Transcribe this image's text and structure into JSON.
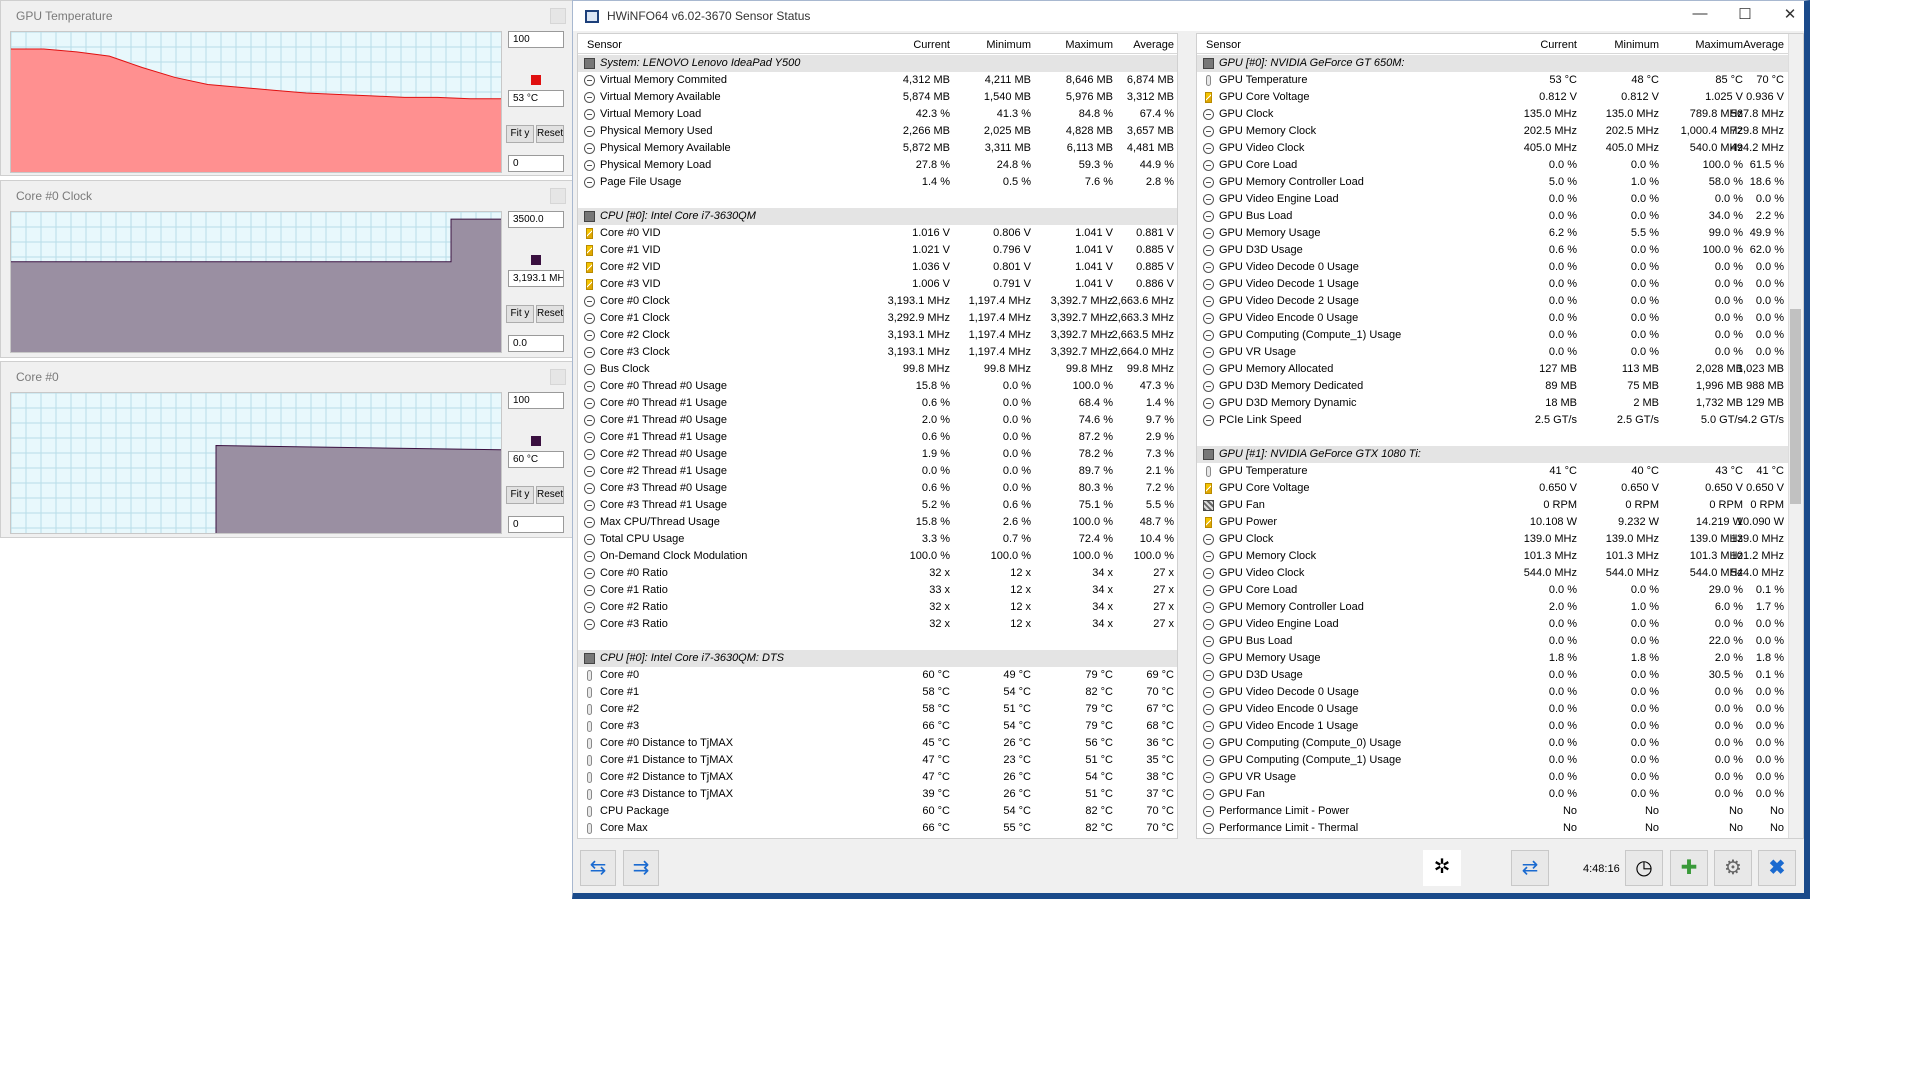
{
  "graphs": [
    {
      "title": "GPU Temperature",
      "max": "100",
      "current": "53 °C",
      "min": "0",
      "fit": "Fit y",
      "reset": "Reset",
      "color": "#e01010",
      "fill": "#ff9090",
      "level": 0.53
    },
    {
      "title": "Core #0 Clock",
      "max": "3500.0",
      "current": "3,193.1 MH:",
      "min": "0.0",
      "fit": "Fit y",
      "reset": "Reset",
      "color": "#3a1040",
      "fill": "#9a8fa2",
      "level": 0.91
    },
    {
      "title": "Core #0",
      "max": "100",
      "current": "60 °C",
      "min": "0",
      "fit": "Fit y",
      "reset": "Reset",
      "color": "#3a1040",
      "fill": "#9a8fa2",
      "level": 0.6
    }
  ],
  "window": {
    "title": "HWiNFO64 v6.02-3670 Sensor Status",
    "minimize": "—",
    "maximize": "☐",
    "close": "✕"
  },
  "columns": {
    "sensor": "Sensor",
    "current": "Current",
    "minimum": "Minimum",
    "maximum": "Maximum",
    "average": "Average"
  },
  "left_rows": [
    {
      "g": 1,
      "n": "System: LENOVO Lenovo IdeaPad Y500"
    },
    {
      "i": "clk",
      "n": "Virtual Memory Commited",
      "c": "4,312 MB",
      "mi": "4,211 MB",
      "ma": "8,646 MB",
      "a": "6,874 MB"
    },
    {
      "i": "clk",
      "n": "Virtual Memory Available",
      "c": "5,874 MB",
      "mi": "1,540 MB",
      "ma": "5,976 MB",
      "a": "3,312 MB"
    },
    {
      "i": "clk",
      "n": "Virtual Memory Load",
      "c": "42.3 %",
      "mi": "41.3 %",
      "ma": "84.8 %",
      "a": "67.4 %"
    },
    {
      "i": "clk",
      "n": "Physical Memory Used",
      "c": "2,266 MB",
      "mi": "2,025 MB",
      "ma": "4,828 MB",
      "a": "3,657 MB"
    },
    {
      "i": "clk",
      "n": "Physical Memory Available",
      "c": "5,872 MB",
      "mi": "3,311 MB",
      "ma": "6,113 MB",
      "a": "4,481 MB"
    },
    {
      "i": "clk",
      "n": "Physical Memory Load",
      "c": "27.8 %",
      "mi": "24.8 %",
      "ma": "59.3 %",
      "a": "44.9 %"
    },
    {
      "i": "clk",
      "n": "Page File Usage",
      "c": "1.4 %",
      "mi": "0.5 %",
      "ma": "7.6 %",
      "a": "2.8 %"
    },
    {
      "e": 1
    },
    {
      "g": 1,
      "n": "CPU [#0]: Intel Core i7-3630QM"
    },
    {
      "i": "volt",
      "n": "Core #0 VID",
      "c": "1.016 V",
      "mi": "0.806 V",
      "ma": "1.041 V",
      "a": "0.881 V"
    },
    {
      "i": "volt",
      "n": "Core #1 VID",
      "c": "1.021 V",
      "mi": "0.796 V",
      "ma": "1.041 V",
      "a": "0.885 V"
    },
    {
      "i": "volt",
      "n": "Core #2 VID",
      "c": "1.036 V",
      "mi": "0.801 V",
      "ma": "1.041 V",
      "a": "0.885 V"
    },
    {
      "i": "volt",
      "n": "Core #3 VID",
      "c": "1.006 V",
      "mi": "0.791 V",
      "ma": "1.041 V",
      "a": "0.886 V"
    },
    {
      "i": "clk",
      "n": "Core #0 Clock",
      "c": "3,193.1 MHz",
      "mi": "1,197.4 MHz",
      "ma": "3,392.7 MHz",
      "a": "2,663.6 MHz"
    },
    {
      "i": "clk",
      "n": "Core #1 Clock",
      "c": "3,292.9 MHz",
      "mi": "1,197.4 MHz",
      "ma": "3,392.7 MHz",
      "a": "2,663.3 MHz"
    },
    {
      "i": "clk",
      "n": "Core #2 Clock",
      "c": "3,193.1 MHz",
      "mi": "1,197.4 MHz",
      "ma": "3,392.7 MHz",
      "a": "2,663.5 MHz"
    },
    {
      "i": "clk",
      "n": "Core #3 Clock",
      "c": "3,193.1 MHz",
      "mi": "1,197.4 MHz",
      "ma": "3,392.7 MHz",
      "a": "2,664.0 MHz"
    },
    {
      "i": "clk",
      "n": "Bus Clock",
      "c": "99.8 MHz",
      "mi": "99.8 MHz",
      "ma": "99.8 MHz",
      "a": "99.8 MHz"
    },
    {
      "i": "clk",
      "n": "Core #0 Thread #0 Usage",
      "c": "15.8 %",
      "mi": "0.0 %",
      "ma": "100.0 %",
      "a": "47.3 %"
    },
    {
      "i": "clk",
      "n": "Core #0 Thread #1 Usage",
      "c": "0.6 %",
      "mi": "0.0 %",
      "ma": "68.4 %",
      "a": "1.4 %"
    },
    {
      "i": "clk",
      "n": "Core #1 Thread #0 Usage",
      "c": "2.0 %",
      "mi": "0.0 %",
      "ma": "74.6 %",
      "a": "9.7 %"
    },
    {
      "i": "clk",
      "n": "Core #1 Thread #1 Usage",
      "c": "0.6 %",
      "mi": "0.0 %",
      "ma": "87.2 %",
      "a": "2.9 %"
    },
    {
      "i": "clk",
      "n": "Core #2 Thread #0 Usage",
      "c": "1.9 %",
      "mi": "0.0 %",
      "ma": "78.2 %",
      "a": "7.3 %"
    },
    {
      "i": "clk",
      "n": "Core #2 Thread #1 Usage",
      "c": "0.0 %",
      "mi": "0.0 %",
      "ma": "89.7 %",
      "a": "2.1 %"
    },
    {
      "i": "clk",
      "n": "Core #3 Thread #0 Usage",
      "c": "0.6 %",
      "mi": "0.0 %",
      "ma": "80.3 %",
      "a": "7.2 %"
    },
    {
      "i": "clk",
      "n": "Core #3 Thread #1 Usage",
      "c": "5.2 %",
      "mi": "0.6 %",
      "ma": "75.1 %",
      "a": "5.5 %"
    },
    {
      "i": "clk",
      "n": "Max CPU/Thread Usage",
      "c": "15.8 %",
      "mi": "2.6 %",
      "ma": "100.0 %",
      "a": "48.7 %"
    },
    {
      "i": "clk",
      "n": "Total CPU Usage",
      "c": "3.3 %",
      "mi": "0.7 %",
      "ma": "72.4 %",
      "a": "10.4 %"
    },
    {
      "i": "clk",
      "n": "On-Demand Clock Modulation",
      "c": "100.0 %",
      "mi": "100.0 %",
      "ma": "100.0 %",
      "a": "100.0 %"
    },
    {
      "i": "clk",
      "n": "Core #0 Ratio",
      "c": "32 x",
      "mi": "12 x",
      "ma": "34 x",
      "a": "27 x"
    },
    {
      "i": "clk",
      "n": "Core #1 Ratio",
      "c": "33 x",
      "mi": "12 x",
      "ma": "34 x",
      "a": "27 x"
    },
    {
      "i": "clk",
      "n": "Core #2 Ratio",
      "c": "32 x",
      "mi": "12 x",
      "ma": "34 x",
      "a": "27 x"
    },
    {
      "i": "clk",
      "n": "Core #3 Ratio",
      "c": "32 x",
      "mi": "12 x",
      "ma": "34 x",
      "a": "27 x"
    },
    {
      "e": 1
    },
    {
      "g": 1,
      "n": "CPU [#0]: Intel Core i7-3630QM: DTS"
    },
    {
      "i": "temp",
      "n": "Core #0",
      "c": "60 °C",
      "mi": "49 °C",
      "ma": "79 °C",
      "a": "69 °C"
    },
    {
      "i": "temp",
      "n": "Core #1",
      "c": "58 °C",
      "mi": "54 °C",
      "ma": "82 °C",
      "a": "70 °C"
    },
    {
      "i": "temp",
      "n": "Core #2",
      "c": "58 °C",
      "mi": "51 °C",
      "ma": "79 °C",
      "a": "67 °C"
    },
    {
      "i": "temp",
      "n": "Core #3",
      "c": "66 °C",
      "mi": "54 °C",
      "ma": "79 °C",
      "a": "68 °C"
    },
    {
      "i": "temp",
      "n": "Core #0 Distance to TjMAX",
      "c": "45 °C",
      "mi": "26 °C",
      "ma": "56 °C",
      "a": "36 °C"
    },
    {
      "i": "temp",
      "n": "Core #1 Distance to TjMAX",
      "c": "47 °C",
      "mi": "23 °C",
      "ma": "51 °C",
      "a": "35 °C"
    },
    {
      "i": "temp",
      "n": "Core #2 Distance to TjMAX",
      "c": "47 °C",
      "mi": "26 °C",
      "ma": "54 °C",
      "a": "38 °C"
    },
    {
      "i": "temp",
      "n": "Core #3 Distance to TjMAX",
      "c": "39 °C",
      "mi": "26 °C",
      "ma": "51 °C",
      "a": "37 °C"
    },
    {
      "i": "temp",
      "n": "CPU Package",
      "c": "60 °C",
      "mi": "54 °C",
      "ma": "82 °C",
      "a": "70 °C"
    },
    {
      "i": "temp",
      "n": "Core Max",
      "c": "66 °C",
      "mi": "55 °C",
      "ma": "82 °C",
      "a": "70 °C"
    }
  ],
  "right_rows": [
    {
      "g": 1,
      "n": "GPU [#0]: NVIDIA GeForce GT 650M:"
    },
    {
      "i": "temp",
      "n": "GPU Temperature",
      "c": "53 °C",
      "mi": "48 °C",
      "ma": "85 °C",
      "a": "70 °C"
    },
    {
      "i": "volt",
      "n": "GPU Core Voltage",
      "c": "0.812 V",
      "mi": "0.812 V",
      "ma": "1.025 V",
      "a": "0.936 V"
    },
    {
      "i": "clk",
      "n": "GPU Clock",
      "c": "135.0 MHz",
      "mi": "135.0 MHz",
      "ma": "789.8 MHz",
      "a": "567.8 MHz"
    },
    {
      "i": "clk",
      "n": "GPU Memory Clock",
      "c": "202.5 MHz",
      "mi": "202.5 MHz",
      "ma": "1,000.4 MHz",
      "a": "729.8 MHz"
    },
    {
      "i": "clk",
      "n": "GPU Video Clock",
      "c": "405.0 MHz",
      "mi": "405.0 MHz",
      "ma": "540.0 MHz",
      "a": "494.2 MHz"
    },
    {
      "i": "clk",
      "n": "GPU Core Load",
      "c": "0.0 %",
      "mi": "0.0 %",
      "ma": "100.0 %",
      "a": "61.5 %"
    },
    {
      "i": "clk",
      "n": "GPU Memory Controller Load",
      "c": "5.0 %",
      "mi": "1.0 %",
      "ma": "58.0 %",
      "a": "18.6 %"
    },
    {
      "i": "clk",
      "n": "GPU Video Engine Load",
      "c": "0.0 %",
      "mi": "0.0 %",
      "ma": "0.0 %",
      "a": "0.0 %"
    },
    {
      "i": "clk",
      "n": "GPU Bus Load",
      "c": "0.0 %",
      "mi": "0.0 %",
      "ma": "34.0 %",
      "a": "2.2 %"
    },
    {
      "i": "clk",
      "n": "GPU Memory Usage",
      "c": "6.2 %",
      "mi": "5.5 %",
      "ma": "99.0 %",
      "a": "49.9 %"
    },
    {
      "i": "clk",
      "n": "GPU D3D Usage",
      "c": "0.6 %",
      "mi": "0.0 %",
      "ma": "100.0 %",
      "a": "62.0 %"
    },
    {
      "i": "clk",
      "n": "GPU Video Decode 0 Usage",
      "c": "0.0 %",
      "mi": "0.0 %",
      "ma": "0.0 %",
      "a": "0.0 %"
    },
    {
      "i": "clk",
      "n": "GPU Video Decode 1 Usage",
      "c": "0.0 %",
      "mi": "0.0 %",
      "ma": "0.0 %",
      "a": "0.0 %"
    },
    {
      "i": "clk",
      "n": "GPU Video Decode 2 Usage",
      "c": "0.0 %",
      "mi": "0.0 %",
      "ma": "0.0 %",
      "a": "0.0 %"
    },
    {
      "i": "clk",
      "n": "GPU Video Encode 0 Usage",
      "c": "0.0 %",
      "mi": "0.0 %",
      "ma": "0.0 %",
      "a": "0.0 %"
    },
    {
      "i": "clk",
      "n": "GPU Computing (Compute_1) Usage",
      "c": "0.0 %",
      "mi": "0.0 %",
      "ma": "0.0 %",
      "a": "0.0 %"
    },
    {
      "i": "clk",
      "n": "GPU VR Usage",
      "c": "0.0 %",
      "mi": "0.0 %",
      "ma": "0.0 %",
      "a": "0.0 %"
    },
    {
      "i": "clk",
      "n": "GPU Memory Allocated",
      "c": "127 MB",
      "mi": "113 MB",
      "ma": "2,028 MB",
      "a": "1,023 MB"
    },
    {
      "i": "clk",
      "n": "GPU D3D Memory Dedicated",
      "c": "89 MB",
      "mi": "75 MB",
      "ma": "1,996 MB",
      "a": "988 MB"
    },
    {
      "i": "clk",
      "n": "GPU D3D Memory Dynamic",
      "c": "18 MB",
      "mi": "2 MB",
      "ma": "1,732 MB",
      "a": "129 MB"
    },
    {
      "i": "clk",
      "n": "PCIe Link Speed",
      "c": "2.5 GT/s",
      "mi": "2.5 GT/s",
      "ma": "5.0 GT/s",
      "a": "4.2 GT/s"
    },
    {
      "e": 1
    },
    {
      "g": 1,
      "n": "GPU [#1]: NVIDIA GeForce GTX 1080 Ti:"
    },
    {
      "i": "temp",
      "n": "GPU Temperature",
      "c": "41 °C",
      "mi": "40 °C",
      "ma": "43 °C",
      "a": "41 °C"
    },
    {
      "i": "volt",
      "n": "GPU Core Voltage",
      "c": "0.650 V",
      "mi": "0.650 V",
      "ma": "0.650 V",
      "a": "0.650 V"
    },
    {
      "i": "fan",
      "n": "GPU Fan",
      "c": "0 RPM",
      "mi": "0 RPM",
      "ma": "0 RPM",
      "a": "0 RPM"
    },
    {
      "i": "volt",
      "n": "GPU Power",
      "c": "10.108 W",
      "mi": "9.232 W",
      "ma": "14.219 W",
      "a": "10.090 W"
    },
    {
      "i": "clk",
      "n": "GPU Clock",
      "c": "139.0 MHz",
      "mi": "139.0 MHz",
      "ma": "139.0 MHz",
      "a": "139.0 MHz"
    },
    {
      "i": "clk",
      "n": "GPU Memory Clock",
      "c": "101.3 MHz",
      "mi": "101.3 MHz",
      "ma": "101.3 MHz",
      "a": "101.2 MHz"
    },
    {
      "i": "clk",
      "n": "GPU Video Clock",
      "c": "544.0 MHz",
      "mi": "544.0 MHz",
      "ma": "544.0 MHz",
      "a": "544.0 MHz"
    },
    {
      "i": "clk",
      "n": "GPU Core Load",
      "c": "0.0 %",
      "mi": "0.0 %",
      "ma": "29.0 %",
      "a": "0.1 %"
    },
    {
      "i": "clk",
      "n": "GPU Memory Controller Load",
      "c": "2.0 %",
      "mi": "1.0 %",
      "ma": "6.0 %",
      "a": "1.7 %"
    },
    {
      "i": "clk",
      "n": "GPU Video Engine Load",
      "c": "0.0 %",
      "mi": "0.0 %",
      "ma": "0.0 %",
      "a": "0.0 %"
    },
    {
      "i": "clk",
      "n": "GPU Bus Load",
      "c": "0.0 %",
      "mi": "0.0 %",
      "ma": "22.0 %",
      "a": "0.0 %"
    },
    {
      "i": "clk",
      "n": "GPU Memory Usage",
      "c": "1.8 %",
      "mi": "1.8 %",
      "ma": "2.0 %",
      "a": "1.8 %"
    },
    {
      "i": "clk",
      "n": "GPU D3D Usage",
      "c": "0.0 %",
      "mi": "0.0 %",
      "ma": "30.5 %",
      "a": "0.1 %"
    },
    {
      "i": "clk",
      "n": "GPU Video Decode 0 Usage",
      "c": "0.0 %",
      "mi": "0.0 %",
      "ma": "0.0 %",
      "a": "0.0 %"
    },
    {
      "i": "clk",
      "n": "GPU Video Encode 0 Usage",
      "c": "0.0 %",
      "mi": "0.0 %",
      "ma": "0.0 %",
      "a": "0.0 %"
    },
    {
      "i": "clk",
      "n": "GPU Video Encode 1 Usage",
      "c": "0.0 %",
      "mi": "0.0 %",
      "ma": "0.0 %",
      "a": "0.0 %"
    },
    {
      "i": "clk",
      "n": "GPU Computing (Compute_0) Usage",
      "c": "0.0 %",
      "mi": "0.0 %",
      "ma": "0.0 %",
      "a": "0.0 %"
    },
    {
      "i": "clk",
      "n": "GPU Computing (Compute_1) Usage",
      "c": "0.0 %",
      "mi": "0.0 %",
      "ma": "0.0 %",
      "a": "0.0 %"
    },
    {
      "i": "clk",
      "n": "GPU VR Usage",
      "c": "0.0 %",
      "mi": "0.0 %",
      "ma": "0.0 %",
      "a": "0.0 %"
    },
    {
      "i": "clk",
      "n": "GPU Fan",
      "c": "0.0 %",
      "mi": "0.0 %",
      "ma": "0.0 %",
      "a": "0.0 %"
    },
    {
      "i": "clk",
      "n": "Performance Limit - Power",
      "c": "No",
      "mi": "No",
      "ma": "No",
      "a": "No"
    },
    {
      "i": "clk",
      "n": "Performance Limit - Thermal",
      "c": "No",
      "mi": "No",
      "ma": "No",
      "a": "No"
    }
  ],
  "footer": {
    "timer": "4:48:16",
    "scroll_position": 0.45
  }
}
